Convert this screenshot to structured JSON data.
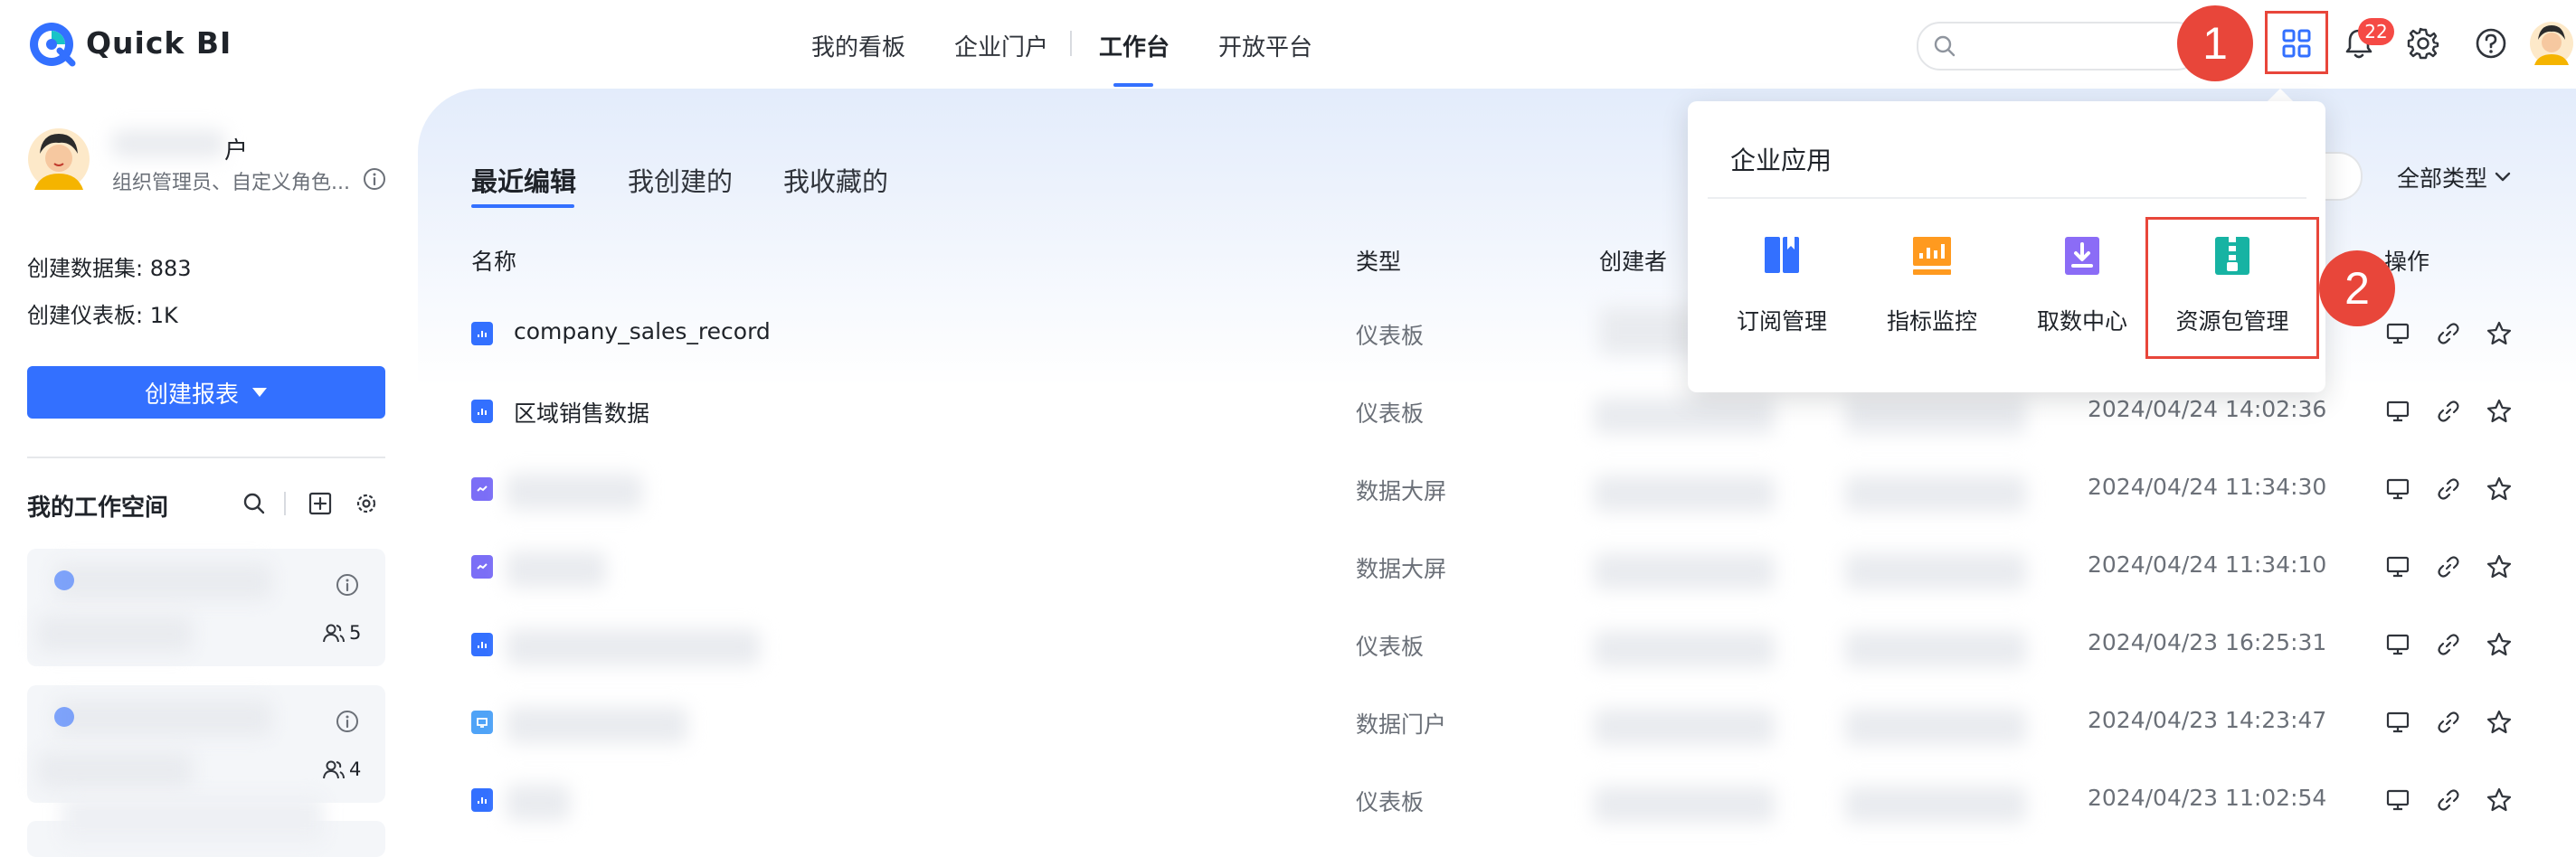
{
  "app": {
    "name": "Quick BI"
  },
  "nav": {
    "items": [
      "我的看板",
      "企业门户",
      "工作台",
      "开放平台"
    ],
    "active": "工作台"
  },
  "header": {
    "search_placeholder": "",
    "notification_count": "22",
    "steps": [
      "1",
      "2"
    ]
  },
  "user": {
    "name": "户",
    "role": "组织管理员、自定义角色..."
  },
  "stats": {
    "datasets_label": "创建数据集: 883",
    "dashboards_label": "创建仪表板: 1K"
  },
  "sidebar": {
    "create_button": "创建报表",
    "workspace_title": "我的工作空间",
    "workspaces": [
      {
        "members": "5"
      },
      {
        "members": "4"
      }
    ]
  },
  "main": {
    "tabs": [
      "最近编辑",
      "我创建的",
      "我收藏的"
    ],
    "filter_label": "全部类型",
    "columns": {
      "name": "名称",
      "type": "类型",
      "creator": "创建者",
      "actions": "操作"
    },
    "rows": [
      {
        "name": "company_sales_record",
        "type": "仪表板",
        "time": ""
      },
      {
        "name": "区域销售数据",
        "type": "仪表板",
        "time": "2024/04/24 14:02:36"
      },
      {
        "name": "",
        "type": "数据大屏",
        "time": "2024/04/24 11:34:30"
      },
      {
        "name": "",
        "type": "数据大屏",
        "time": "2024/04/24 11:34:10"
      },
      {
        "name": "",
        "type": "仪表板",
        "time": "2024/04/23 16:25:31"
      },
      {
        "name": "",
        "type": "数据门户",
        "time": "2024/04/23 14:23:47"
      },
      {
        "name": "",
        "type": "仪表板",
        "time": "2024/04/23 11:02:54"
      }
    ]
  },
  "dropdown": {
    "title": "企业应用",
    "items": [
      {
        "label": "订阅管理",
        "icon": "subscription-icon"
      },
      {
        "label": "指标监控",
        "icon": "metric-monitor-icon"
      },
      {
        "label": "取数中心",
        "icon": "data-fetch-icon"
      },
      {
        "label": "资源包管理",
        "icon": "resource-package-icon"
      }
    ]
  },
  "colors": {
    "primary": "#3370ff",
    "highlight": "#e8463a",
    "badge": "#f54a45"
  }
}
